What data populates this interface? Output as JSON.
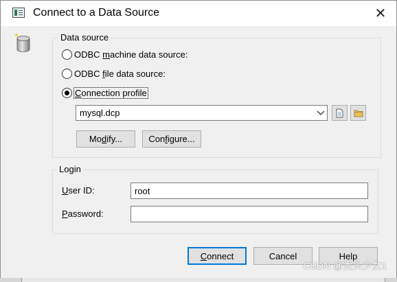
{
  "window": {
    "title": "Connect to a Data Source",
    "close_glyph": "✕"
  },
  "data_source": {
    "group_label": "Data source",
    "options": [
      {
        "label_pre": "ODBC ",
        "label_mnemonic": "m",
        "label_post": "achine data source:",
        "checked": false
      },
      {
        "label_pre": "ODBC ",
        "label_mnemonic": "f",
        "label_post": "ile data source:",
        "checked": false
      },
      {
        "label_pre": "",
        "label_mnemonic": "C",
        "label_post": "onnection profile",
        "checked": true
      }
    ],
    "profile_value": "mysql.dcp",
    "new_icon": "document-icon",
    "browse_icon": "folder-icon",
    "modify_pre": "Mo",
    "modify_mnemonic": "d",
    "modify_post": "ify...",
    "configure_pre": "Con",
    "configure_mnemonic": "f",
    "configure_post": "igure..."
  },
  "login": {
    "group_label": "Login",
    "userid_mnemonic": "U",
    "userid_post": "ser ID:",
    "userid_value": "root",
    "password_mnemonic": "P",
    "password_post": "assword:",
    "password_value": ""
  },
  "buttons": {
    "connect_mnemonic": "C",
    "connect_post": "onnect",
    "cancel": "Cancel",
    "help": "Help"
  },
  "watermark": "CSDN @秃头少女1",
  "colors": {
    "accent": "#0078d7",
    "dialog_bg": "#f0f0f0"
  }
}
